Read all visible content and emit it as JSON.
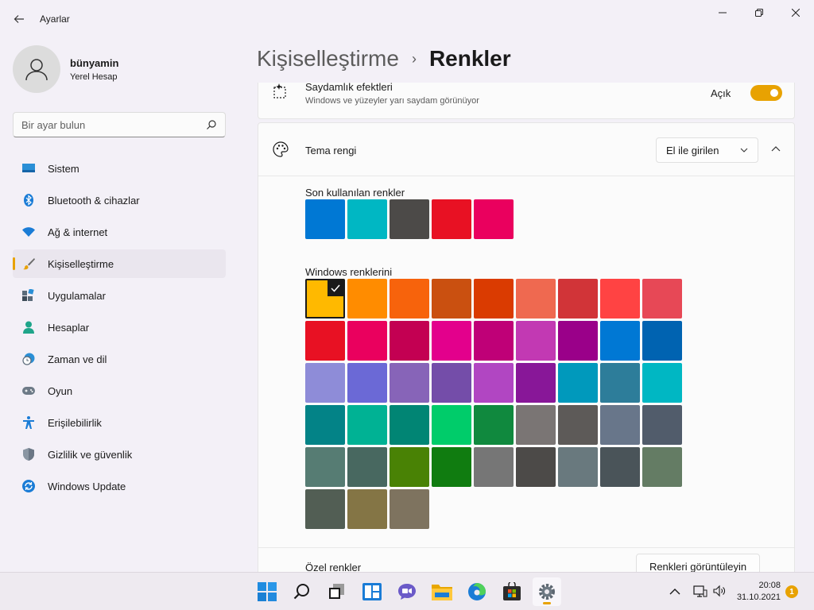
{
  "window": {
    "app_title": "Ayarlar",
    "controls": {
      "minimize": "─",
      "maximize": "▢",
      "close": "✕"
    }
  },
  "profile": {
    "name": "bünyamin",
    "account_type": "Yerel Hesap"
  },
  "search": {
    "placeholder": "Bir ayar bulun"
  },
  "sidebar": {
    "items": [
      {
        "label": "Sistem",
        "icon": "system-icon",
        "active": false
      },
      {
        "label": "Bluetooth & cihazlar",
        "icon": "bluetooth-icon",
        "active": false
      },
      {
        "label": "Ağ & internet",
        "icon": "wifi-icon",
        "active": false
      },
      {
        "label": "Kişiselleştirme",
        "icon": "brush-icon",
        "active": true
      },
      {
        "label": "Uygulamalar",
        "icon": "apps-icon",
        "active": false
      },
      {
        "label": "Hesaplar",
        "icon": "accounts-icon",
        "active": false
      },
      {
        "label": "Zaman ve dil",
        "icon": "clock-globe-icon",
        "active": false
      },
      {
        "label": "Oyun",
        "icon": "gamepad-icon",
        "active": false
      },
      {
        "label": "Erişilebilirlik",
        "icon": "accessibility-icon",
        "active": false
      },
      {
        "label": "Gizlilik ve güvenlik",
        "icon": "shield-icon",
        "active": false
      },
      {
        "label": "Windows Update",
        "icon": "update-icon",
        "active": false
      }
    ]
  },
  "breadcrumb": {
    "parent": "Kişiselleştirme",
    "separator": "›",
    "current": "Renkler"
  },
  "transparency": {
    "title": "Saydamlık efektleri",
    "description": "Windows ve yüzeyler yarı saydam görünüyor",
    "state_label": "Açık",
    "enabled": true
  },
  "accent": {
    "title": "Tema rengi",
    "dropdown_value": "El ile girilen",
    "recent_label": "Son kullanılan renkler",
    "recent_colors": [
      "#0078d4",
      "#00b7c3",
      "#4c4a48",
      "#e81123",
      "#ea005e"
    ],
    "windows_label": "Windows renklerini",
    "windows_colors": [
      "#ffb900",
      "#ff8c00",
      "#f7630c",
      "#ca5010",
      "#da3b01",
      "#ef6950",
      "#d13438",
      "#ff4343",
      "#e74856",
      "#e81123",
      "#ea005e",
      "#c30052",
      "#e3008c",
      "#bf0077",
      "#c239b3",
      "#9a0089",
      "#0078d4",
      "#0063b1",
      "#8e8cd8",
      "#6b69d6",
      "#8764b8",
      "#744da9",
      "#b146c2",
      "#881798",
      "#0099bc",
      "#2d7d9a",
      "#00b7c3",
      "#038387",
      "#00b294",
      "#018574",
      "#00cc6a",
      "#10893e",
      "#7a7574",
      "#5d5a58",
      "#68768a",
      "#515c6b",
      "#567c73",
      "#486860",
      "#498205",
      "#107c10",
      "#767676",
      "#4c4a48",
      "#69797e",
      "#4a5459",
      "#647c64",
      "#525e54",
      "#847545",
      "#7e735f"
    ],
    "selected_index": 0,
    "custom_label": "Özel renkler",
    "view_colors_button": "Renkleri görüntüleyin"
  },
  "taskbar": {
    "apps": [
      "windows-start-icon",
      "search-icon",
      "task-view-icon",
      "widgets-icon",
      "chat-icon",
      "file-explorer-icon",
      "edge-icon",
      "store-icon",
      "settings-icon"
    ],
    "clock_time": "20:08",
    "clock_date": "31.10.2021",
    "notification_count": "1"
  }
}
